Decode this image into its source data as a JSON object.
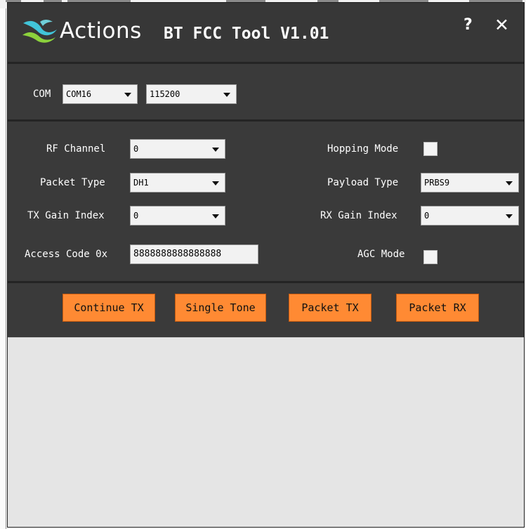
{
  "window": {
    "brand": "Actions",
    "title_rest": "BT FCC Tool V1.01",
    "help_label": "?",
    "close_label": "✕"
  },
  "serial": {
    "com_label": "COM",
    "port_value": "COM16",
    "baud_value": "115200"
  },
  "settings": {
    "rf_channel": {
      "label": "RF Channel",
      "value": "0"
    },
    "hopping_mode": {
      "label": "Hopping Mode",
      "checked": false
    },
    "packet_type": {
      "label": "Packet Type",
      "value": "DH1"
    },
    "payload_type": {
      "label": "Payload Type",
      "value": "PRBS9"
    },
    "tx_gain_index": {
      "label": "TX Gain Index",
      "value": "0"
    },
    "rx_gain_index": {
      "label": "RX Gain Index",
      "value": "0"
    },
    "access_code": {
      "label": "Access Code 0x",
      "value": "8888888888888888"
    },
    "agc_mode": {
      "label": "AGC Mode",
      "checked": false
    }
  },
  "actions": {
    "continue_tx": "Continue TX",
    "single_tone": "Single Tone",
    "packet_tx": "Packet TX",
    "packet_rx": "Packet RX"
  },
  "colors": {
    "window_bg": "#3a3a3a",
    "button_orange": "#ff8a33",
    "log_bg": "#e5e5e5"
  }
}
